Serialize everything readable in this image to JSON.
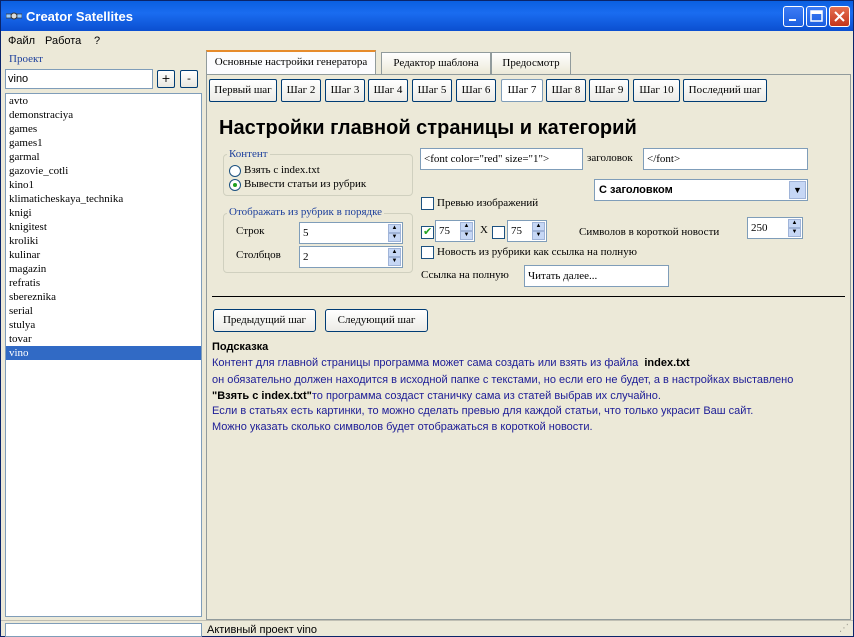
{
  "window": {
    "title": "Creator Satellites"
  },
  "menu": [
    "Файл",
    "Работа",
    "?"
  ],
  "project": {
    "label": "Проект",
    "input_value": "vino",
    "add_label": "+",
    "remove_label": "-",
    "items": [
      "avto",
      "demonstraciya",
      "games",
      "games1",
      "garmal",
      "gazovie_cotli",
      "kino1",
      "klimaticheskaya_technika",
      "knigi",
      "knigitest",
      "kroliki",
      "kulinar",
      "magazin",
      "refratis",
      "sbereznika",
      "serial",
      "stulya",
      "tovar",
      "vino"
    ],
    "selected": "vino"
  },
  "tabs": [
    {
      "label": "Основные настройки генератора",
      "active": true
    },
    {
      "label": "Редактор шаблона",
      "active": false
    },
    {
      "label": "Предосмотр",
      "active": false
    }
  ],
  "steps": [
    "Первый шаг",
    "Шаг 2",
    "Шаг 3",
    "Шаг 4",
    "Шаг 5",
    "Шаг 6",
    "Шаг 7",
    "Шаг 8",
    "Шаг 9",
    "Шаг 10",
    "Последний шаг"
  ],
  "active_step": "Шаг 7",
  "heading": "Настройки главной страницы и категорий",
  "content_group": {
    "label": "Контент",
    "option1": "Взять с index.txt",
    "option2": "Вывести статьи из рубрик",
    "selected": 2
  },
  "rubric_group": {
    "label": "Отображать из рубрик в порядке",
    "rows_label": "Строк",
    "rows_value": "5",
    "cols_label": "Столбцов",
    "cols_value": "2"
  },
  "header_open": "<font color=\"red\" size=\"1\">",
  "header_label": "заголовок",
  "header_close": "</font>",
  "header_mode": "С заголовком",
  "preview_images": {
    "label": "Превью изображений",
    "checked": false
  },
  "image_size": {
    "width": "75",
    "x": "X",
    "height": "75",
    "width_checked": true,
    "height_checked": false
  },
  "short_news": {
    "label": "Символов в короткой новости",
    "value": "250"
  },
  "news_as_link": {
    "label": "Новость из рубрики как ссылка на полную",
    "checked": false
  },
  "full_link": {
    "label": "Ссылка на полную",
    "value": "Читать далее..."
  },
  "buttons": {
    "prev": "Предыдущий шаг",
    "next": "Следующий шаг"
  },
  "hint": {
    "title": "Подсказка",
    "line1": "Контент для главной страницы программа может сама создать или взять из файла",
    "line1_bold": "index.txt",
    "line2": "он обязательно должен находится в исходной папке с текстами, но если его не будет, а в настройках выставлено",
    "line3_bold": "\"Взять с index.txt\"",
    "line3": "то программа создаст станичку сама из статей выбрав их случайно.",
    "line4": "Если в статьях есть картинки, то можно сделать превью для каждой статьи, что только украсит Ваш сайт.",
    "line5": "Можно указать сколько символов будет отображаться в короткой новости."
  },
  "status": {
    "text": "Активный проект vino"
  }
}
